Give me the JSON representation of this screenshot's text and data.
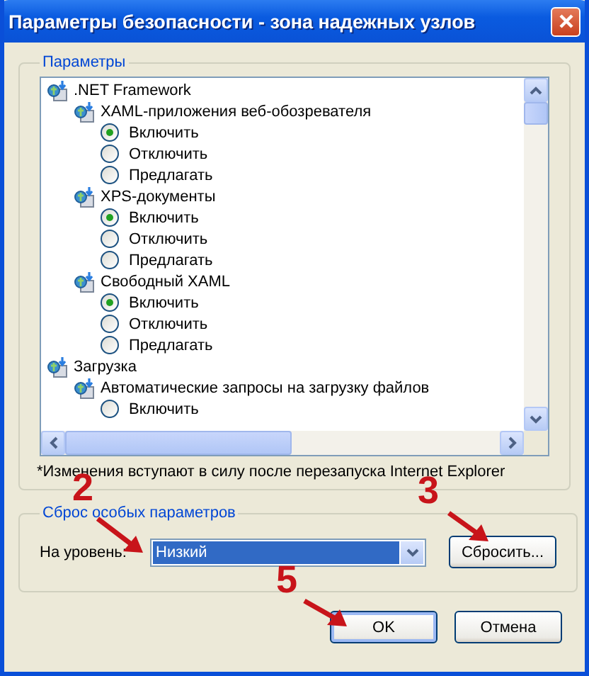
{
  "window": {
    "title": "Параметры безопасности - зона надежных узлов"
  },
  "settings_group": {
    "title": "Параметры",
    "tree": [
      {
        "label": ".NET Framework",
        "children": [
          {
            "label": "XAML-приложения веб-обозревателя",
            "children": [
              {
                "kind": "radio",
                "label": "Включить",
                "selected": true
              },
              {
                "kind": "radio",
                "label": "Отключить",
                "selected": false
              },
              {
                "kind": "radio",
                "label": "Предлагать",
                "selected": false
              }
            ]
          },
          {
            "label": "XPS-документы",
            "children": [
              {
                "kind": "radio",
                "label": "Включить",
                "selected": true
              },
              {
                "kind": "radio",
                "label": "Отключить",
                "selected": false
              },
              {
                "kind": "radio",
                "label": "Предлагать",
                "selected": false
              }
            ]
          },
          {
            "label": "Свободный XAML",
            "children": [
              {
                "kind": "radio",
                "label": "Включить",
                "selected": true
              },
              {
                "kind": "radio",
                "label": "Отключить",
                "selected": false
              },
              {
                "kind": "radio",
                "label": "Предлагать",
                "selected": false
              }
            ]
          }
        ]
      },
      {
        "label": "Загрузка",
        "children": [
          {
            "label": "Автоматические запросы на загрузку файлов",
            "children": [
              {
                "kind": "radio",
                "label": "Включить",
                "selected": false
              }
            ]
          }
        ]
      }
    ],
    "note": "*Изменения вступают в силу после перезапуска Internet Explorer"
  },
  "reset_group": {
    "title": "Сброс особых параметров",
    "level_label": "На уровень:",
    "level_value": "Низкий",
    "reset_button": "Сбросить..."
  },
  "buttons": [
    {
      "label": "OK",
      "default": true
    },
    {
      "label": "Отмена",
      "default": false
    }
  ],
  "annotations": [
    {
      "label": "2"
    },
    {
      "label": "3"
    },
    {
      "label": "5"
    }
  ]
}
